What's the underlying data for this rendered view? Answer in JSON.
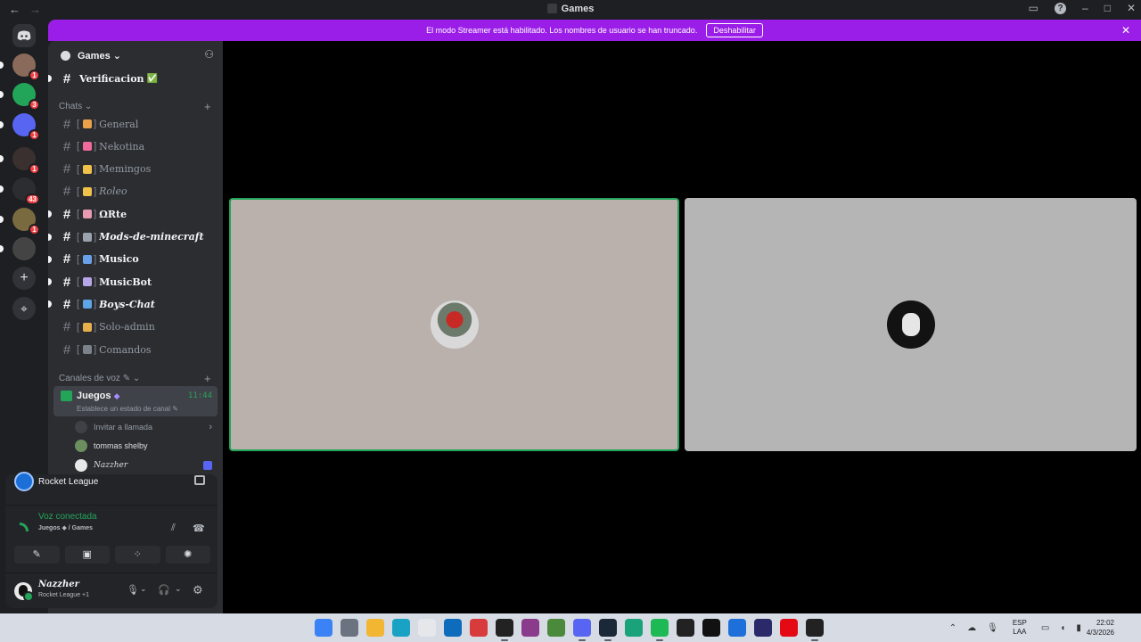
{
  "window": {
    "title": "Games",
    "nav_back": "←",
    "nav_forward": "→",
    "help": "?",
    "minimize": "–",
    "maximize": "□",
    "close": "✕"
  },
  "banner": {
    "text": "El modo Streamer está habilitado. Los nombres de usuario se han truncado.",
    "button": "Deshabilitar",
    "close": "✕"
  },
  "rail": {
    "servers": [
      {
        "name": "server-1",
        "badge": "1",
        "color": "#8a6a5a"
      },
      {
        "name": "server-2",
        "badge": "3",
        "color": "#23a559"
      },
      {
        "name": "server-3",
        "badge": "1",
        "color": "#5865f2"
      },
      {
        "name": "server-4",
        "badge": "1",
        "color": "#3a3030"
      },
      {
        "name": "server-5",
        "badge": "43",
        "color": "#2b2d31"
      },
      {
        "name": "server-6",
        "badge": "1",
        "color": "#7a6a40"
      },
      {
        "name": "server-7",
        "badge": "",
        "color": "#444"
      }
    ],
    "add_server": "+",
    "discover": "⌖"
  },
  "sidebar": {
    "guild_name": "Games",
    "guild_caret": "⌄",
    "top_channel": {
      "name": "Verificacion",
      "check": "✅"
    },
    "chats_category": "Chats",
    "category_plus": "+",
    "channels": [
      {
        "name": "General",
        "bracket_open": "[",
        "bracket_close": "]",
        "emoji_color": "#e9a24a"
      },
      {
        "name": "Nekotina",
        "bracket_open": "[",
        "bracket_close": "]",
        "emoji_color": "#f06a9b"
      },
      {
        "name": "Memingos",
        "bracket_open": "[",
        "bracket_close": "]",
        "emoji_color": "#f0c14b"
      },
      {
        "name": "Roleo",
        "bracket_open": "[",
        "bracket_close": "]",
        "emoji_color": "#f0c14b"
      },
      {
        "name": "ΩRte",
        "bracket_open": "[",
        "bracket_close": "]",
        "emoji_color": "#e89ab3"
      },
      {
        "name": "Mods-de-minecraft",
        "bracket_open": "[",
        "bracket_close": "]",
        "emoji_color": "#9aa3ad"
      },
      {
        "name": "Musico",
        "bracket_open": "[",
        "bracket_close": "]",
        "emoji_color": "#6aa0e8"
      },
      {
        "name": "MusicBot",
        "bracket_open": "[",
        "bracket_close": "]",
        "emoji_color": "#b6a6e8"
      },
      {
        "name": "Boys-Chat",
        "bracket_open": "[",
        "bracket_close": "]",
        "emoji_color": "#5ea5e8"
      },
      {
        "name": "Solo-admin",
        "bracket_open": "[",
        "bracket_close": "]",
        "emoji_color": "#e8b04a"
      },
      {
        "name": "Comandos",
        "bracket_open": "[",
        "bracket_close": "]",
        "emoji_color": "#7d828a"
      }
    ],
    "voice_category": "Canales de voz",
    "voice_channel": {
      "name": "Juegos",
      "emoji": "◆",
      "time": "11:44",
      "status_placeholder": "Establece un estado de canal"
    },
    "invite_label": "Invitar a llamada",
    "invite_chevron": "›",
    "voice_members": [
      {
        "name": "tommas shelby",
        "avatar_color": "#6b8f5e"
      },
      {
        "name": "Nazzher",
        "avatar_color": "#e8e8e8"
      }
    ]
  },
  "activity": {
    "game": "Rocket League",
    "voice_status": "Voz conectada",
    "voice_location": "Juegos ◆ / Games",
    "controls": [
      "✎",
      "▣",
      "⁘",
      "✺"
    ]
  },
  "user": {
    "name": "Nazzher",
    "status": "Rocket League +1",
    "mic": "🎙",
    "headset": "🎧",
    "settings": "⚙",
    "caret": "⌄"
  },
  "taskbar": {
    "language": "ESP",
    "layout": "LAA",
    "time": "22:02",
    "date": "4/3/2026",
    "apps": [
      {
        "name": "start",
        "color": "#3b82f6"
      },
      {
        "name": "task-view",
        "color": "#6b7280"
      },
      {
        "name": "file-explorer",
        "color": "#f2b632"
      },
      {
        "name": "edge",
        "color": "#1aa2c4"
      },
      {
        "name": "store",
        "color": "#e5e7eb"
      },
      {
        "name": "outlook",
        "color": "#0f6cbd"
      },
      {
        "name": "app-red",
        "color": "#d83b3b"
      },
      {
        "name": "epic-games",
        "color": "#222"
      },
      {
        "name": "app-purple",
        "color": "#8b3b8b"
      },
      {
        "name": "minecraft",
        "color": "#4a8a3a"
      },
      {
        "name": "discord",
        "color": "#5865f2"
      },
      {
        "name": "steam",
        "color": "#1b2838"
      },
      {
        "name": "app-green",
        "color": "#1aa37a"
      },
      {
        "name": "spotify",
        "color": "#1db954"
      },
      {
        "name": "app-gear",
        "color": "#222"
      },
      {
        "name": "chatgpt",
        "color": "#111"
      },
      {
        "name": "app-blue",
        "color": "#1e6fd9"
      },
      {
        "name": "app-circle",
        "color": "#2a2a6a"
      },
      {
        "name": "netflix",
        "color": "#e50914"
      },
      {
        "name": "obs",
        "color": "#222"
      }
    ]
  }
}
